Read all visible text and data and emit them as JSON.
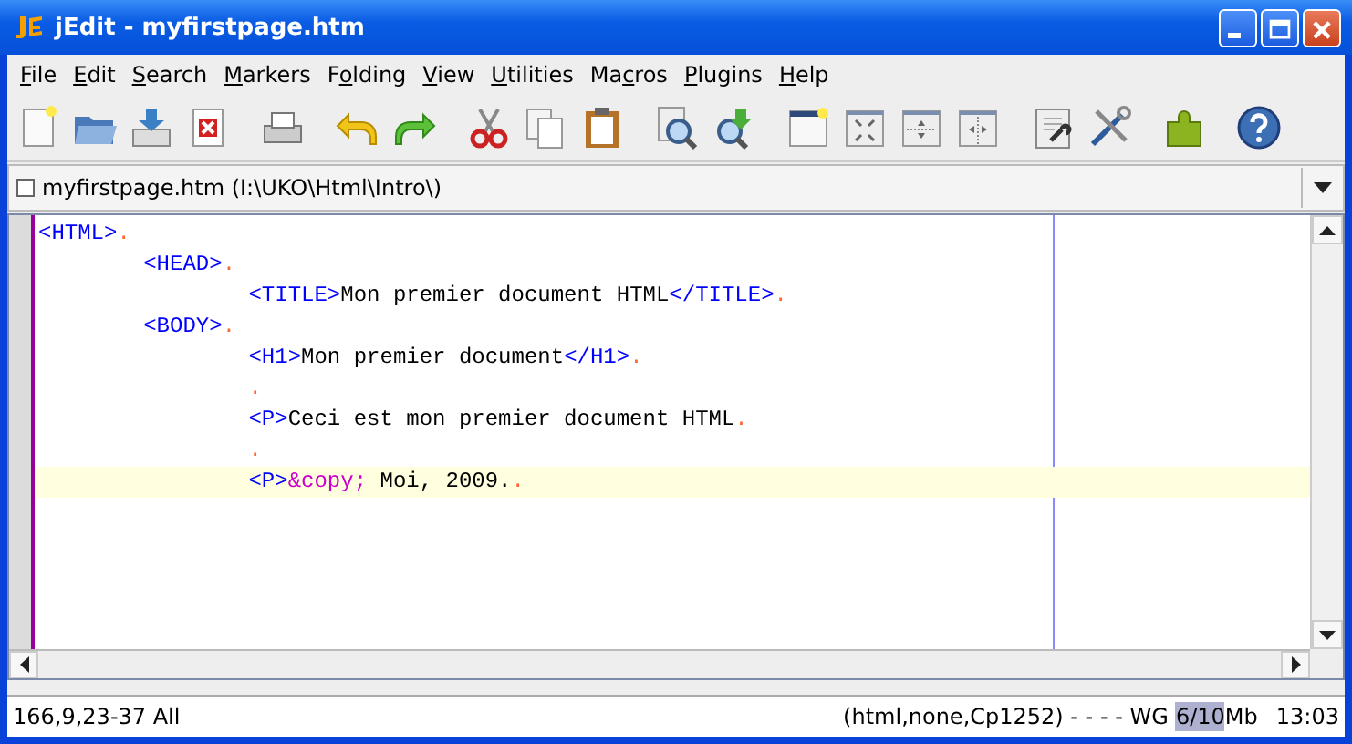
{
  "window": {
    "title": "jEdit - myfirstpage.htm"
  },
  "menu": [
    {
      "mnemonic": "F",
      "after": "ile"
    },
    {
      "mnemonic": "E",
      "after": "dit"
    },
    {
      "mnemonic": "S",
      "after": "earch"
    },
    {
      "mnemonic": "M",
      "after": "arkers"
    },
    {
      "before": "F",
      "mnemonic": "o",
      "after": "lding"
    },
    {
      "mnemonic": "V",
      "after": "iew"
    },
    {
      "mnemonic": "U",
      "after": "tilities"
    },
    {
      "before": "Ma",
      "mnemonic": "c",
      "after": "ros"
    },
    {
      "mnemonic": "P",
      "after": "lugins"
    },
    {
      "mnemonic": "H",
      "after": "elp"
    }
  ],
  "buffer_switcher": {
    "value": "myfirstpage.htm (I:\\UKO\\Html\\Intro\\)"
  },
  "editor": {
    "lines": [
      {
        "current": false,
        "segments": [
          {
            "kind": "tag",
            "text": "<HTML>"
          },
          {
            "kind": "eol",
            "text": "."
          }
        ]
      },
      {
        "current": false,
        "segments": [
          {
            "kind": "tag",
            "text": "        <HEAD>"
          },
          {
            "kind": "eol",
            "text": "."
          }
        ]
      },
      {
        "current": false,
        "segments": [
          {
            "kind": "tag",
            "text": "                <TITLE>"
          },
          {
            "kind": "text",
            "text": "Mon premier document HTML"
          },
          {
            "kind": "tag",
            "text": "</TITLE>"
          },
          {
            "kind": "eol",
            "text": "."
          }
        ]
      },
      {
        "current": false,
        "segments": [
          {
            "kind": "tag",
            "text": "        <BODY>"
          },
          {
            "kind": "eol",
            "text": "."
          }
        ]
      },
      {
        "current": false,
        "segments": [
          {
            "kind": "tag",
            "text": "                <H1>"
          },
          {
            "kind": "text",
            "text": "Mon premier document"
          },
          {
            "kind": "tag",
            "text": "</H1>"
          },
          {
            "kind": "eol",
            "text": "."
          }
        ]
      },
      {
        "current": false,
        "segments": [
          {
            "kind": "eol",
            "text": "                ."
          }
        ]
      },
      {
        "current": false,
        "segments": [
          {
            "kind": "tag",
            "text": "                <P>"
          },
          {
            "kind": "text",
            "text": "Ceci est mon premier document HTML"
          },
          {
            "kind": "eol",
            "text": "."
          }
        ]
      },
      {
        "current": false,
        "segments": [
          {
            "kind": "eol",
            "text": "                ."
          }
        ]
      },
      {
        "current": true,
        "segments": [
          {
            "kind": "tag",
            "text": "                <P>"
          },
          {
            "kind": "entity",
            "text": "&copy;"
          },
          {
            "kind": "text",
            "text": " Moi, 2009."
          },
          {
            "kind": "eol",
            "text": "."
          }
        ]
      }
    ]
  },
  "status_bar": {
    "caret": "166,9,23-37 All",
    "mode": "(html,none,Cp1252) - - - - WG",
    "memory": {
      "text": "6/10Mb",
      "level": 0.6
    },
    "time": "13:03"
  }
}
